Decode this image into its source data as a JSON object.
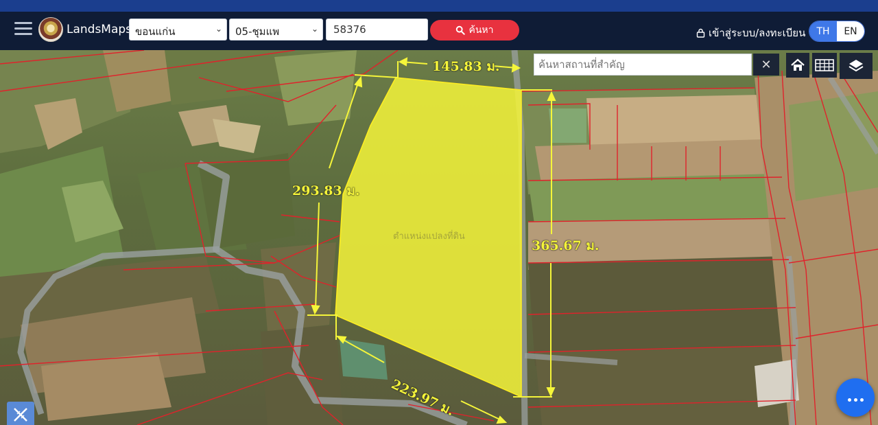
{
  "header": {
    "brand": "LandsMaps",
    "province": "ขอนแก่น",
    "district": "05-ชุมแพ",
    "parcel_number": "58376",
    "search_label": "ค้นหา",
    "login_label": "เข้าสู่ระบบ/ลงทะเบียน",
    "lang_th": "TH",
    "lang_en": "EN"
  },
  "map": {
    "place_search_placeholder": "ค้นหาสถานที่สำคัญ",
    "clear_symbol": "✕",
    "parcel_label": "ตำแหน่งแปลงที่ดิน",
    "dimensions": {
      "top": "145.83 ม.",
      "left": "293.83 ม.",
      "right": "365.67 ม.",
      "bottom": "223.97 ม."
    },
    "icons": [
      "hamburger-icon",
      "logo-icon",
      "search-icon",
      "lock-icon",
      "home-icon",
      "grid-icon",
      "layers-icon",
      "more-icon",
      "tools-icon"
    ],
    "colors": {
      "parcel_fill": "#f5f53a",
      "boundary": "#e0222b",
      "accent": "#3f78e8",
      "search_button": "#e8323f"
    }
  }
}
